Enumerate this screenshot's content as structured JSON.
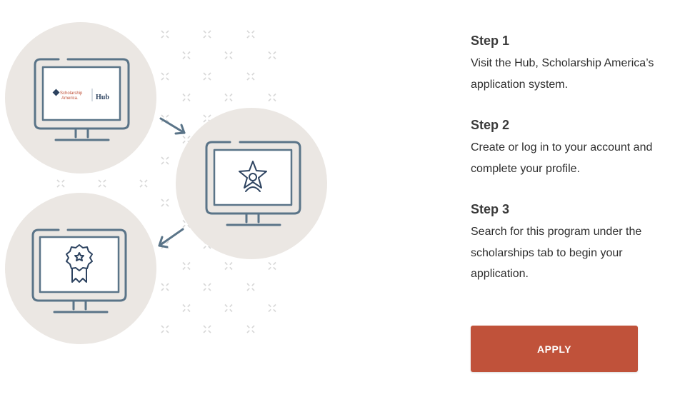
{
  "illustration": {
    "hub_logo_line1": "Scholarship",
    "hub_logo_line2": "America.",
    "hub_logo_word": "Hub",
    "colors": {
      "circle": "#ebe7e3",
      "monitor_stroke": "#5a7488",
      "arrow": "#5a7488",
      "sparkle": "#d7d7d7",
      "icon_dark": "#2d4360",
      "logo_red": "#c0523a",
      "logo_blue": "#2d4360"
    },
    "icons": [
      "scholarship-america-hub-logo",
      "star-person-icon",
      "award-badge-icon",
      "arrow-down-right-icon",
      "arrow-down-left-icon"
    ]
  },
  "steps": [
    {
      "title": "Step 1",
      "text": "Visit the Hub, Scholarship America’s application system."
    },
    {
      "title": "Step 2",
      "text": "Create or log in to your account and complete your profile."
    },
    {
      "title": "Step 3",
      "text": "Search for this program under the scholarships tab to begin your application."
    }
  ],
  "apply_button": {
    "label": "APPLY",
    "color": "#c0523a"
  }
}
